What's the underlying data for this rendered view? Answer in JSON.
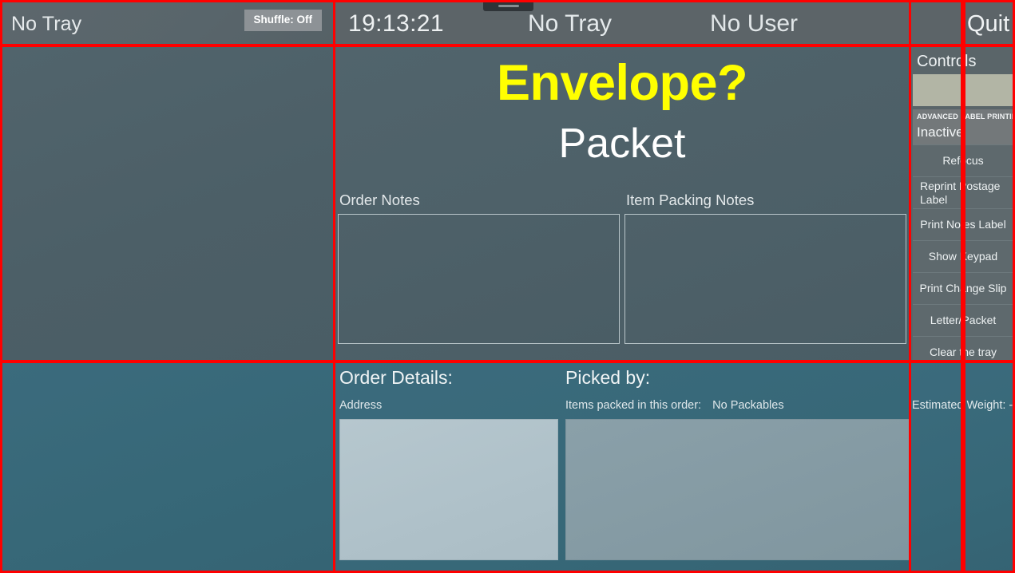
{
  "topbar": {
    "tray_status_left": "No Tray",
    "shuffle_chip": "Shuffle: Off",
    "clock": "19:13:21",
    "tray_status": "No Tray",
    "user_status": "No User",
    "quit_label": "Quit"
  },
  "main": {
    "title": "Envelope?",
    "subtitle": "Packet",
    "order_notes_label": "Order Notes",
    "order_notes_value": "",
    "item_packing_notes_label": "Item Packing Notes",
    "item_packing_notes_value": ""
  },
  "bottom": {
    "order_details_title": "Order Details:",
    "picked_by_title": "Picked by:",
    "picked_by_value": "",
    "address_label": "Address",
    "address_value": "",
    "items_packed_label": "Items packed in this order:",
    "items_packed_value": "No Packables"
  },
  "controls": {
    "title": "Controls",
    "swatches": [
      "",
      ""
    ],
    "alp_title": "ADVANCED LABEL PRINTING",
    "alp_state": "Inactive",
    "buttons": [
      {
        "label": "Refocus"
      },
      {
        "label": "Reprint Postage Label"
      },
      {
        "label": "Print Notes Label"
      },
      {
        "label": "Show Keypad"
      },
      {
        "label": "Print Change Slip"
      },
      {
        "label": "Letter/Packet"
      },
      {
        "label": "Clear the tray"
      }
    ]
  },
  "weight": {
    "estimated_weight": "Estimated Weight: -g"
  },
  "colors": {
    "accent_title": "#ffff00",
    "panel_slate": "#4c5f67",
    "panel_teal": "#376878",
    "header_grey": "#5c6468",
    "swatch_khaki": "#b2b5a5",
    "address_box": "#b0c2ca",
    "packed_box": "#849aa3",
    "annotation_red": "#ff0000"
  }
}
